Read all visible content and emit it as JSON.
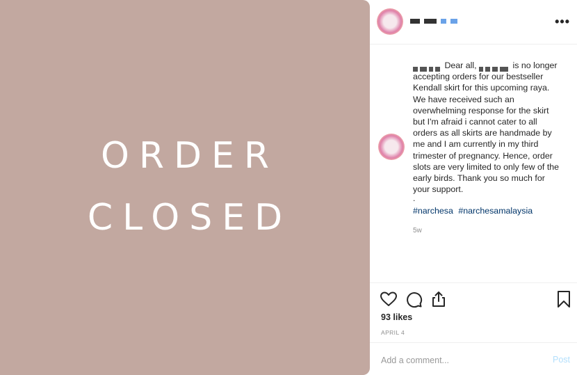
{
  "media": {
    "line1": "ORDER",
    "line2": "CLOSED",
    "background": "#c2a8a0"
  },
  "header": {
    "more_label": "•••"
  },
  "caption": {
    "text_part1": "Dear all,",
    "text_part2": "is no longer accepting orders for our bestseller Kendall skirt for this upcoming raya. We have received such an overwhelming response for the skirt but I'm afraid i cannot cater to all orders as all skirts are handmade by me and I am currently in my third trimester of pregnancy. Hence, order slots are very limited to only few of the early birds. Thank you so much for your support.",
    "dot": ".",
    "hashtags": [
      "#narchesa",
      "#narchesamalaysia"
    ],
    "time": "5w"
  },
  "actions": {
    "like_icon": "heart-icon",
    "comment_icon": "comment-icon",
    "share_icon": "share-icon",
    "save_icon": "bookmark-icon",
    "likes": "93 likes",
    "date": "APRIL 4"
  },
  "comment_box": {
    "placeholder": "Add a comment...",
    "post_label": "Post"
  },
  "colors": {
    "link": "#003569",
    "muted": "#8e8e8e",
    "post_disabled": "#b2dffc"
  }
}
